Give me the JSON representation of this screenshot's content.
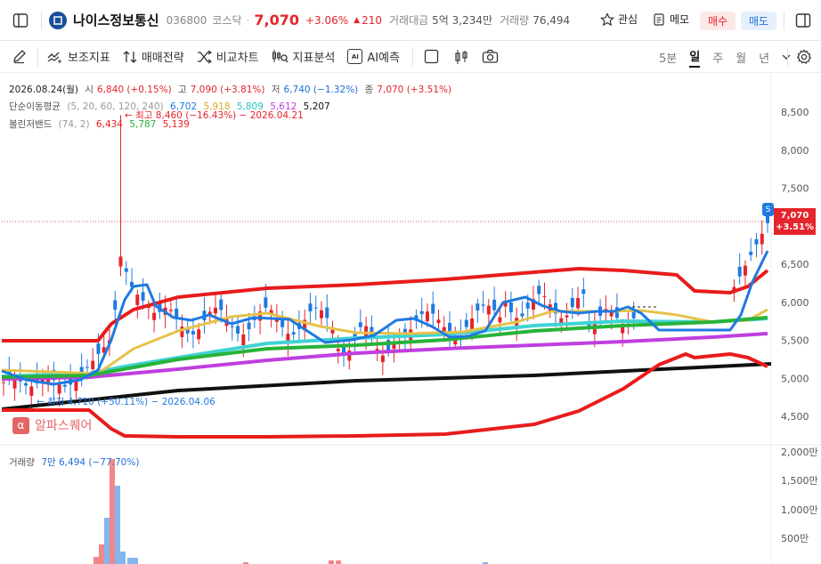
{
  "header": {
    "name": "나이스정보통신",
    "code": "036800",
    "market": "코스닥",
    "price": "7,070",
    "change_pct": "+3.06%",
    "change_arrow": "▲",
    "change_amt": "210",
    "tv_label": "거래대금",
    "tv_value": "5억 3,234만",
    "vol_label": "거래량",
    "vol_value": "76,494",
    "fav_label": "관심",
    "memo_label": "메모",
    "buy_label": "매수",
    "sell_label": "매도"
  },
  "toolbar": {
    "indicators": "보조지표",
    "strategy": "매매전략",
    "compare": "비교차트",
    "analysis": "지표분석",
    "ai_forecast": "AI예측",
    "ai_chip": "AI",
    "periods": [
      "5분",
      "일",
      "주",
      "월",
      "년"
    ],
    "active_period": "일"
  },
  "legend": {
    "date": "2026.08.24(월)",
    "open_label": "시",
    "open": "6,840 (+0.15%)",
    "high_label": "고",
    "high": "7,090 (+3.81%)",
    "low_label": "저",
    "low": "6,740 (−1.32%)",
    "close_label": "종",
    "close": "7,070 (+3.51%)",
    "ma_label": "단순이동평균",
    "ma_params": "(5, 20, 60, 120, 240)",
    "ma_values": [
      "6,702",
      "5,918",
      "5,809",
      "5,612",
      "5,207"
    ],
    "bb_label": "볼린저밴드",
    "bb_params": "(74, 2)",
    "bb_values": [
      "6,434",
      "5,787",
      "5,139"
    ],
    "vol_label": "거래량",
    "vol_value": "7만 6,494 (−77.70%)"
  },
  "annotations": {
    "high": "최고 8,460 (−16.43%) − 2026.04.21",
    "low": "최저 4,710 (+50.11%) − 2026.04.06",
    "watermark": "알파스퀘어",
    "marker": "S"
  },
  "price_axis": {
    "ticks": [
      "8,500",
      "8,000",
      "7,500",
      "7,000",
      "6,500",
      "6,000",
      "5,500",
      "5,000",
      "4,500"
    ],
    "current": "7,070",
    "current_pct": "+3.51%"
  },
  "volume_axis": {
    "ticks": [
      "2,000만",
      "1,500만",
      "1,000만",
      "500만"
    ]
  },
  "colors": {
    "up": "#e5242b",
    "down": "#1f7ae0",
    "ma5": "#1f7ae0",
    "ma20": "#e6c24a",
    "ma60": "#3fd3d3",
    "ma120": "#bf3fe0",
    "ma240": "#111111",
    "bb_upper": "#e81c1c",
    "bb_mid": "#28b33a",
    "bb_lower": "#e81c1c",
    "watermark": "#e05555"
  }
}
